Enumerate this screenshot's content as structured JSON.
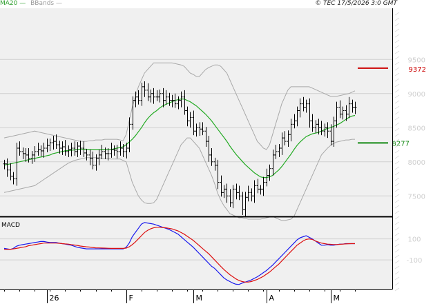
{
  "header": {
    "ma_label": "MA20",
    "bb_label": "BBands",
    "timestamp": "© TEC 17/5/2026 3:0 GMT"
  },
  "macd_panel_label": "MACD",
  "colors": {
    "panel_bg": "#f0f0f0",
    "grid": "#cfcfcf",
    "price_bars": "#000000",
    "ma20": "#22aa22",
    "bbands": "#a8a8a8",
    "resistance": "#cc0000",
    "support": "#118811",
    "macd_line": "#1a1aee",
    "signal_line": "#dd1111"
  },
  "chart_data": [
    {
      "type": "line",
      "name": "price",
      "x_labels": [
        "26",
        "F",
        "M",
        "A",
        "M"
      ],
      "y_ticks": [
        7500,
        8000,
        8500,
        9000,
        9500
      ],
      "ylim": [
        7200,
        10250
      ],
      "grid": true,
      "price_close": [
        7970,
        7880,
        7790,
        7750,
        8200,
        8150,
        8120,
        8100,
        8050,
        8100,
        8150,
        8180,
        8160,
        8200,
        8240,
        8280,
        8300,
        8250,
        8200,
        8220,
        8150,
        8180,
        8200,
        8150,
        8230,
        8200,
        8130,
        8100,
        8050,
        7950,
        8050,
        8100,
        8150,
        8120,
        8120,
        8180,
        8170,
        8150,
        8200,
        8150,
        8200,
        8550,
        8900,
        8950,
        8900,
        9100,
        9050,
        8950,
        9000,
        8950,
        8950,
        9000,
        8900,
        8950,
        8900,
        8900,
        8850,
        8900,
        8950,
        8750,
        8600,
        8650,
        8450,
        8500,
        8480,
        8450,
        8300,
        8100,
        8000,
        7950,
        7700,
        7550,
        7600,
        7500,
        7400,
        7600,
        7550,
        7500,
        7300,
        7480,
        7550,
        7500,
        7650,
        7600,
        7600,
        7700,
        7800,
        7900,
        8100,
        8150,
        8200,
        8350,
        8300,
        8400,
        8550,
        8600,
        8750,
        8850,
        8800,
        8850,
        8600,
        8500,
        8550,
        8500,
        8450,
        8500,
        8450,
        8300,
        8600,
        8800,
        8700,
        8750,
        8700,
        8850,
        8800,
        8800
      ],
      "ma20": [
        7950,
        7960,
        7970,
        7980,
        7990,
        8000,
        8010,
        8020,
        8030,
        8040,
        8050,
        8060,
        8070,
        8080,
        8090,
        8100,
        8120,
        8130,
        8140,
        8150,
        8160,
        8165,
        8170,
        8175,
        8180,
        8185,
        8185,
        8185,
        8180,
        8180,
        8180,
        8180,
        8180,
        8180,
        8180,
        8180,
        8190,
        8200,
        8210,
        8220,
        8250,
        8290,
        8330,
        8380,
        8440,
        8500,
        8570,
        8630,
        8680,
        8720,
        8750,
        8790,
        8820,
        8840,
        8860,
        8880,
        8900,
        8910,
        8920,
        8920,
        8900,
        8880,
        8850,
        8820,
        8780,
        8740,
        8700,
        8650,
        8600,
        8540,
        8480,
        8420,
        8360,
        8300,
        8230,
        8170,
        8110,
        8060,
        8010,
        7960,
        7920,
        7880,
        7840,
        7810,
        7780,
        7770,
        7770,
        7780,
        7800,
        7840,
        7880,
        7930,
        7990,
        8050,
        8110,
        8180,
        8240,
        8290,
        8330,
        8370,
        8390,
        8410,
        8420,
        8430,
        8450,
        8470,
        8490,
        8500,
        8520,
        8540,
        8560,
        8590,
        8620,
        8650,
        8670,
        8680
      ],
      "bb_upper": [
        8350,
        8360,
        8370,
        8380,
        8390,
        8400,
        8410,
        8420,
        8430,
        8440,
        8450,
        8440,
        8430,
        8420,
        8410,
        8400,
        8390,
        8380,
        8370,
        8360,
        8350,
        8340,
        8330,
        8320,
        8310,
        8300,
        8300,
        8300,
        8310,
        8310,
        8320,
        8320,
        8320,
        8330,
        8330,
        8330,
        8330,
        8330,
        8320,
        8310,
        8400,
        8600,
        8800,
        8950,
        9100,
        9200,
        9300,
        9350,
        9400,
        9450,
        9450,
        9450,
        9450,
        9450,
        9450,
        9450,
        9440,
        9430,
        9420,
        9400,
        9350,
        9300,
        9280,
        9250,
        9250,
        9300,
        9350,
        9380,
        9400,
        9420,
        9420,
        9400,
        9350,
        9300,
        9200,
        9100,
        9000,
        8900,
        8800,
        8700,
        8600,
        8500,
        8400,
        8300,
        8250,
        8200,
        8180,
        8250,
        8400,
        8550,
        8700,
        8850,
        8950,
        9050,
        9100,
        9100,
        9100,
        9100,
        9100,
        9100,
        9100,
        9080,
        9060,
        9040,
        9020,
        9000,
        8980,
        8960,
        8960,
        8960,
        8970,
        8980,
        8990,
        9000,
        9020,
        9040
      ],
      "bb_lower": [
        7550,
        7560,
        7570,
        7580,
        7590,
        7600,
        7610,
        7620,
        7630,
        7640,
        7650,
        7680,
        7710,
        7740,
        7770,
        7800,
        7830,
        7860,
        7890,
        7920,
        7950,
        7980,
        8000,
        8020,
        8030,
        8040,
        8050,
        8060,
        8060,
        8060,
        8060,
        8060,
        8050,
        8050,
        8050,
        8040,
        8040,
        8040,
        8040,
        8020,
        8000,
        7850,
        7700,
        7600,
        7500,
        7440,
        7400,
        7390,
        7390,
        7400,
        7450,
        7550,
        7650,
        7750,
        7850,
        7950,
        8050,
        8150,
        8250,
        8300,
        8350,
        8350,
        8300,
        8250,
        8200,
        8100,
        8000,
        7900,
        7800,
        7680,
        7540,
        7440,
        7360,
        7300,
        7240,
        7220,
        7200,
        7180,
        7180,
        7170,
        7160,
        7160,
        7160,
        7160,
        7160,
        7170,
        7180,
        7190,
        7200,
        7180,
        7160,
        7140,
        7140,
        7150,
        7160,
        7200,
        7300,
        7400,
        7500,
        7600,
        7700,
        7800,
        7900,
        8000,
        8100,
        8150,
        8200,
        8240,
        8270,
        8290,
        8300,
        8310,
        8320,
        8320,
        8330,
        8330
      ],
      "resistance": 9372,
      "support": 8277,
      "resistance_label": "9372",
      "support_label": "8277"
    },
    {
      "type": "line",
      "name": "MACD",
      "y_ticks": [
        100,
        -100
      ],
      "y_tick_labels": [
        "100",
        "-100"
      ],
      "ylim": [
        -380,
        300
      ],
      "macd": [
        10,
        5,
        0,
        10,
        30,
        40,
        45,
        50,
        55,
        60,
        65,
        70,
        75,
        75,
        70,
        65,
        65,
        65,
        60,
        55,
        50,
        45,
        40,
        30,
        20,
        15,
        10,
        5,
        5,
        5,
        5,
        5,
        5,
        5,
        5,
        5,
        5,
        5,
        5,
        5,
        20,
        60,
        120,
        160,
        200,
        240,
        255,
        250,
        245,
        240,
        230,
        220,
        210,
        200,
        190,
        175,
        160,
        145,
        120,
        95,
        70,
        45,
        20,
        -10,
        -40,
        -70,
        -100,
        -130,
        -160,
        -180,
        -210,
        -240,
        -270,
        -290,
        -305,
        -320,
        -330,
        -332,
        -320,
        -310,
        -300,
        -290,
        -275,
        -260,
        -240,
        -220,
        -200,
        -175,
        -150,
        -120,
        -90,
        -60,
        -30,
        0,
        30,
        60,
        90,
        110,
        120,
        130,
        115,
        100,
        80,
        60,
        40,
        40,
        45,
        40,
        40,
        45,
        50,
        50,
        55,
        55,
        55,
        55
      ],
      "signal": [
        0,
        0,
        0,
        5,
        10,
        15,
        20,
        25,
        35,
        40,
        45,
        50,
        55,
        60,
        60,
        60,
        60,
        60,
        58,
        55,
        52,
        50,
        45,
        42,
        38,
        32,
        28,
        25,
        22,
        18,
        15,
        14,
        13,
        12,
        11,
        10,
        10,
        10,
        10,
        10,
        12,
        25,
        45,
        70,
        100,
        130,
        160,
        180,
        195,
        205,
        210,
        210,
        208,
        205,
        200,
        195,
        185,
        175,
        160,
        145,
        125,
        105,
        85,
        60,
        35,
        10,
        -15,
        -40,
        -70,
        -100,
        -130,
        -160,
        -190,
        -215,
        -240,
        -260,
        -280,
        -295,
        -305,
        -310,
        -310,
        -305,
        -295,
        -285,
        -270,
        -255,
        -235,
        -215,
        -190,
        -165,
        -140,
        -110,
        -80,
        -50,
        -20,
        10,
        40,
        60,
        80,
        95,
        100,
        95,
        80,
        70,
        60,
        55,
        50,
        48,
        46,
        46,
        48,
        50,
        52,
        54,
        55,
        55
      ]
    }
  ]
}
